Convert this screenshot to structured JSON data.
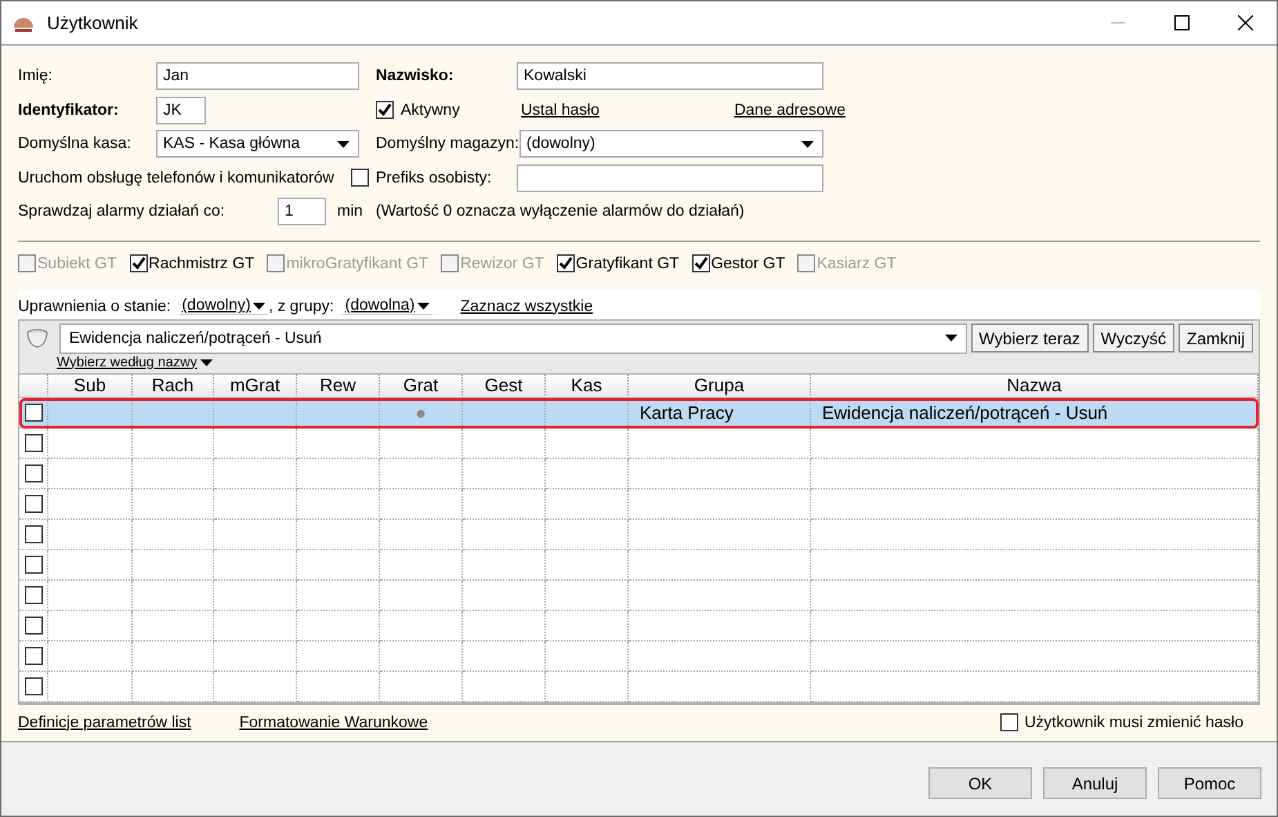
{
  "window": {
    "title": "Użytkownik"
  },
  "form": {
    "first_name": {
      "label": "Imię:",
      "value": "Jan"
    },
    "last_name": {
      "label": "Nazwisko:",
      "value": "Kowalski"
    },
    "identifier": {
      "label": "Identyfikator:",
      "value": "JK"
    },
    "active": {
      "label": "Aktywny",
      "checked": true
    },
    "links": [
      "Ustal hasło",
      "Dane adresowe"
    ],
    "cash_register": {
      "label": "Domyślna kasa:",
      "value": "KAS - Kasa główna"
    },
    "warehouse": {
      "label": "Domyślny magazyn:",
      "value": "(dowolny)"
    },
    "phones": {
      "label": "Uruchom obsługę telefonów i komunikatorów",
      "checked": false
    },
    "prefix": {
      "label": "Prefiks osobisty:"
    },
    "alarms": {
      "label": "Sprawdzaj alarmy działań co:",
      "value": "1",
      "unit": "min",
      "note": "(Wartość 0 oznacza wyłączenie alarmów do działań)"
    }
  },
  "modules": [
    {
      "label": "Subiekt GT",
      "checked": false
    },
    {
      "label": "Rachmistrz GT",
      "checked": true
    },
    {
      "label": "mikroGratyfikant GT",
      "checked": false
    },
    {
      "label": "Rewizor GT",
      "checked": false
    },
    {
      "label": "Gratyfikant GT",
      "checked": true
    },
    {
      "label": "Gestor GT",
      "checked": true
    },
    {
      "label": "Kasiarz GT",
      "checked": false
    }
  ],
  "filter": {
    "state_label": "Uprawnienia o stanie:",
    "state_value": "(dowolny)",
    "group_label": ", z grupy:",
    "group_value": "(dowolna)",
    "select_all": "Zaznacz wszystkie",
    "search_value": "Ewidencja naliczeń/potrąceń - Usuń",
    "buttons": [
      "Wybierz teraz",
      "Wyczyść",
      "Zamknij"
    ],
    "by_name": "Wybierz według nazwy"
  },
  "table": {
    "columns": [
      "Sub",
      "Rach",
      "mGrat",
      "Rew",
      "Grat",
      "Gest",
      "Kas",
      "Grupa",
      "Nazwa"
    ],
    "rows": [
      {
        "checked": false,
        "selected": true,
        "cells": [
          "",
          "",
          "",
          "",
          "●",
          "",
          "",
          "Karta Pracy",
          "Ewidencja naliczeń/potrąceń - Usuń"
        ]
      },
      {
        "checked": false,
        "selected": false
      },
      {
        "checked": false,
        "selected": false
      },
      {
        "checked": false,
        "selected": false
      },
      {
        "checked": false,
        "selected": false
      },
      {
        "checked": false,
        "selected": false
      },
      {
        "checked": false,
        "selected": false
      },
      {
        "checked": false,
        "selected": false
      },
      {
        "checked": false,
        "selected": false
      },
      {
        "checked": false,
        "selected": false
      }
    ]
  },
  "footer": {
    "links": [
      "Definicje parametrów list",
      "Formatowanie Warunkowe"
    ],
    "must_change_password": {
      "label": "Użytkownik musi zmienić hasło",
      "checked": false
    }
  },
  "buttons": [
    "OK",
    "Anuluj",
    "Pomoc"
  ]
}
